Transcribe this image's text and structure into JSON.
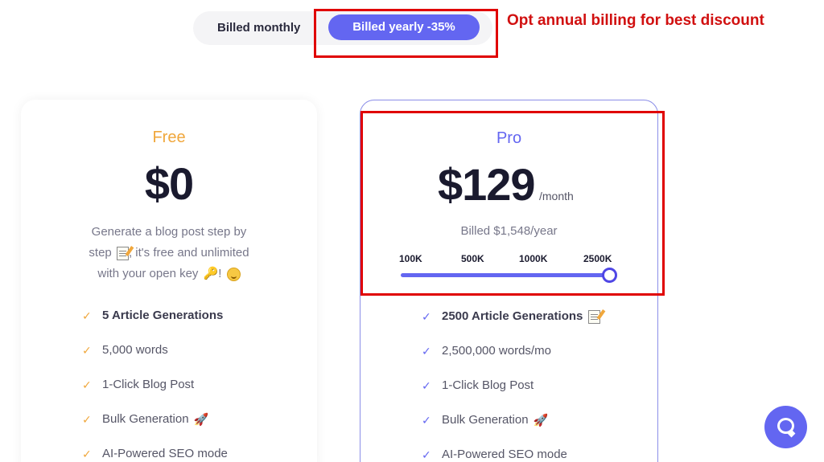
{
  "billing_toggle": {
    "monthly_label": "Billed monthly",
    "yearly_label": "Billed yearly -35%",
    "selected": "yearly"
  },
  "annotation": {
    "text": "Opt annual billing for best discount",
    "color": "#e00000"
  },
  "free_plan": {
    "name": "Free",
    "price": "$0",
    "description_line1": "Generate a blog post step by",
    "description_line2": "step",
    "description_line2b": ", it's free and unlimited",
    "description_line3": "with your open key",
    "description_line3b": "!",
    "features": [
      {
        "text": "5 Article Generations",
        "bold": true,
        "icon": ""
      },
      {
        "text": "5,000 words",
        "bold": false,
        "icon": ""
      },
      {
        "text": "1-Click Blog Post",
        "bold": false,
        "icon": ""
      },
      {
        "text": "Bulk Generation",
        "bold": false,
        "icon": "rocket-icon"
      },
      {
        "text": "AI-Powered SEO mode",
        "bold": false,
        "icon": ""
      }
    ],
    "accent": "#f0a73c"
  },
  "pro_plan": {
    "name": "Pro",
    "price": "$129",
    "period": "/month",
    "billed_note": "Billed $1,548/year",
    "slider": {
      "ticks": [
        "100K",
        "500K",
        "1000K",
        "2500K"
      ],
      "selected": "2500K",
      "level": 1.0
    },
    "features": [
      {
        "text": "2500 Article Generations",
        "bold": true,
        "icon": "memo-icon"
      },
      {
        "text": "2,500,000 words/mo",
        "bold": false,
        "icon": ""
      },
      {
        "text": "1-Click Blog Post",
        "bold": false,
        "icon": ""
      },
      {
        "text": "Bulk Generation",
        "bold": false,
        "icon": "rocket-icon"
      },
      {
        "text": "AI-Powered SEO mode",
        "bold": false,
        "icon": ""
      }
    ],
    "accent": "#6366f1"
  },
  "icons": {
    "check": "✓",
    "key": "🔑",
    "rocket": "🚀"
  },
  "chat_widget": {
    "icon": "chat-bubble-icon"
  }
}
